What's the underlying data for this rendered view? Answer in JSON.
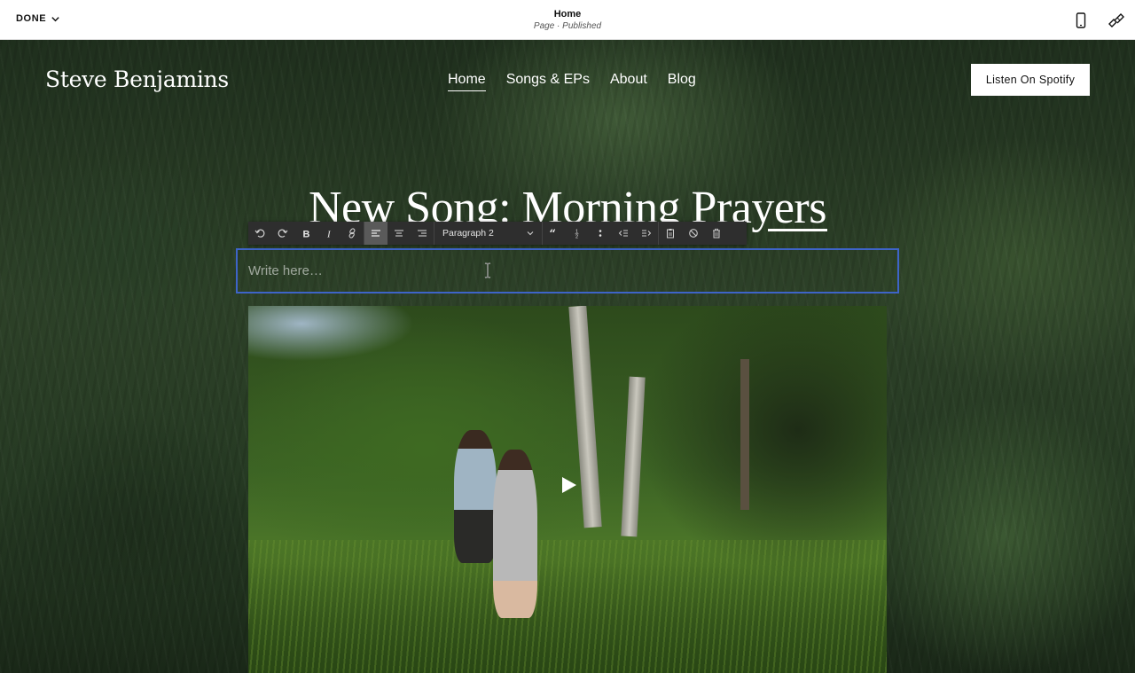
{
  "editor": {
    "done_label": "DONE",
    "page_title": "Home",
    "page_status": "Page · Published",
    "icons": [
      "mobile-preview-icon",
      "design-brush-icon"
    ]
  },
  "site": {
    "title": "Steve Benjamins",
    "nav": [
      {
        "label": "Home",
        "active": true
      },
      {
        "label": "Songs & EPs",
        "active": false
      },
      {
        "label": "About",
        "active": false
      },
      {
        "label": "Blog",
        "active": false
      }
    ],
    "cta_label": "Listen On Spotify",
    "headline": "New Song: Morning Prayers"
  },
  "toolbar": {
    "style_select": "Paragraph 2",
    "align_active": "left",
    "buttons": [
      "undo-icon",
      "redo-icon",
      "bold-icon",
      "italic-icon",
      "link-icon",
      "align-left-icon",
      "align-center-icon",
      "align-right-icon",
      "blockquote-icon",
      "ordered-list-icon",
      "bullet-list-icon",
      "outdent-icon",
      "indent-icon",
      "paste-icon",
      "clear-format-icon",
      "delete-icon"
    ]
  },
  "text_block": {
    "placeholder": "Write here…"
  },
  "video": {
    "play_icon": "play-icon"
  },
  "colors": {
    "focus_border": "#3e64c8",
    "toolbar_bg": "#2e2e2e"
  }
}
